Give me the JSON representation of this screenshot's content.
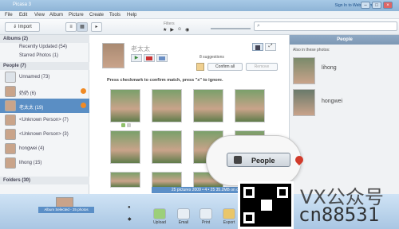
{
  "window": {
    "title": "Picasa 3",
    "sign_in": "Sign In to Web Albums"
  },
  "menu": [
    "File",
    "Edit",
    "View",
    "Album",
    "Picture",
    "Create",
    "Tools",
    "Help"
  ],
  "toolbar": {
    "import_label": "Import",
    "filters_label": "Filters"
  },
  "sidebar": {
    "albums_header": "Albums (2)",
    "albums": [
      {
        "label": "Recently Updated (54)"
      },
      {
        "label": "Starred Photos (1)"
      }
    ],
    "people_header": "People (7)",
    "people": [
      {
        "label": "Unnamed (73)",
        "badge": false,
        "selected": false
      },
      {
        "label": "奶奶 (6)",
        "badge": true,
        "selected": false
      },
      {
        "label": "老太太 (19)",
        "badge": true,
        "selected": true
      },
      {
        "label": "<Unknown Person> (7)",
        "badge": false,
        "selected": false
      },
      {
        "label": "<Unknown Person> (3)",
        "badge": false,
        "selected": false
      },
      {
        "label": "hongwei (4)",
        "badge": false,
        "selected": false
      },
      {
        "label": "lihong (15)",
        "badge": false,
        "selected": false
      }
    ],
    "folders_header": "Folders (30)"
  },
  "main": {
    "person_name": "老太太",
    "suggestions_count": "8 suggestions",
    "confirm_all": "Confirm all",
    "remove": "Remove",
    "instruction": "Press checkmark to confirm match, press \"x\" to ignore."
  },
  "right_panel": {
    "title": "People",
    "subtitle": "Also in these photos:",
    "people": [
      "lihong",
      "hongwei"
    ]
  },
  "status": {
    "text": "25 pictures   2009 • 4 • 25   35.2MB on disk",
    "album_selected": "Album Selected - 25 photos"
  },
  "bottom_buttons": [
    "Upload",
    "Email",
    "Print",
    "Export"
  ],
  "callout": {
    "label": "People"
  },
  "watermark": {
    "line1": "VX公众号",
    "line2": "cn88531"
  }
}
